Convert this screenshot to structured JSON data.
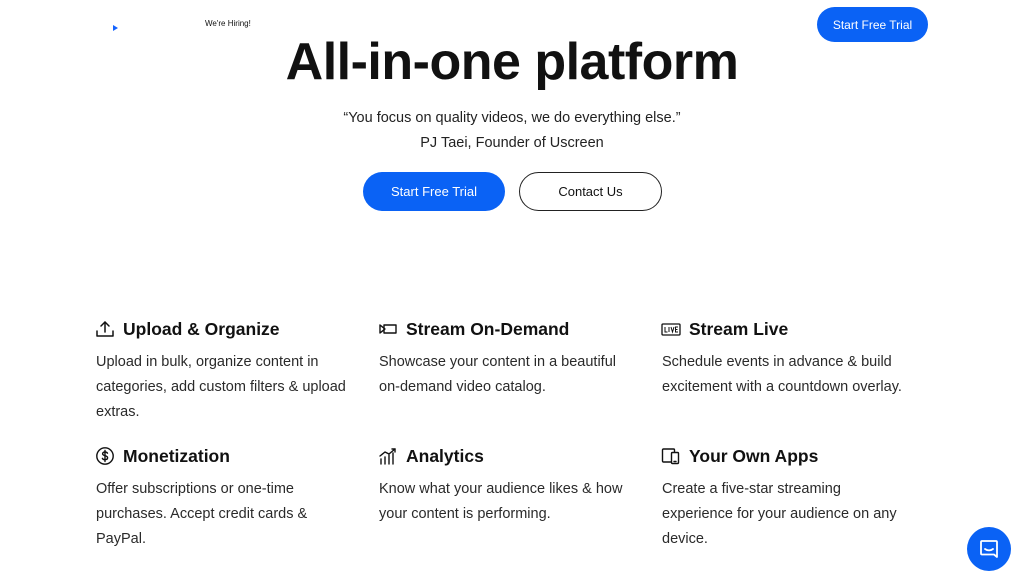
{
  "header": {
    "hiring_label": "We're Hiring!",
    "cta_label": "Start Free Trial"
  },
  "hero": {
    "title": "All-in-one platform",
    "quote": "“You focus on quality videos, we do everything else.”",
    "attribution": "PJ Taei, Founder of Uscreen",
    "primary_cta": "Start Free Trial",
    "secondary_cta": "Contact Us"
  },
  "features": [
    {
      "icon": "upload-icon",
      "title": "Upload & Organize",
      "desc": "Upload in bulk, organize content in categories, add custom filters & upload extras."
    },
    {
      "icon": "video-icon",
      "title": "Stream On-Demand",
      "desc": "Showcase your content in a beautiful on-demand video catalog."
    },
    {
      "icon": "live-icon",
      "title": "Stream Live",
      "desc": "Schedule events in advance & build excitement with a countdown overlay."
    },
    {
      "icon": "dollar-icon",
      "title": "Monetization",
      "desc": "Offer subscriptions or one-time purchases. Accept credit cards & PayPal."
    },
    {
      "icon": "analytics-icon",
      "title": "Analytics",
      "desc": "Know what your audience likes & how your content is performing."
    },
    {
      "icon": "devices-icon",
      "title": "Your Own Apps",
      "desc": "Create a five-star streaming experience for your audience on any device."
    }
  ],
  "colors": {
    "accent": "#0a62f5",
    "text": "#111111"
  }
}
